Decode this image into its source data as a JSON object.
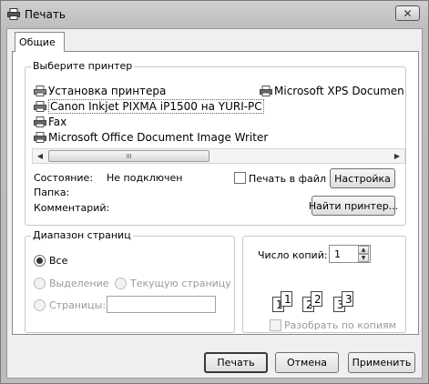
{
  "window": {
    "title": "Печать",
    "close_glyph": "✕"
  },
  "tabs": [
    {
      "label": "Общие"
    }
  ],
  "printer_select": {
    "legend": "Выберите принтер",
    "printers": [
      {
        "name": "Установка принтера"
      },
      {
        "name": "Microsoft XPS Documen"
      },
      {
        "name": "Canon Inkjet PIXMA iP1500 на YURI-PC",
        "selected": true
      },
      {
        "name": "Fax"
      },
      {
        "name": "Microsoft Office Document Image Writer"
      }
    ],
    "scroll_thumb_grip": "III",
    "status_label": "Состояние:",
    "status_value": "Не подключен",
    "folder_label": "Папка:",
    "comment_label": "Комментарий:",
    "print_to_file_label": "Печать в файл",
    "settings_button": "Настройка",
    "find_printer_button": "Найти принтер..."
  },
  "page_range": {
    "legend": "Диапазон страниц",
    "all_label": "Все",
    "selection_label": "Выделение",
    "current_page_label": "Текущую страницу",
    "pages_label": "Страницы:",
    "pages_value": ""
  },
  "copies": {
    "label": "Число копий:",
    "value": "1",
    "collate_label": "Разобрать по копиям",
    "collate_pages": [
      "1",
      "1",
      "2",
      "2",
      "3",
      "3"
    ]
  },
  "footer": {
    "print_button": "Печать",
    "cancel_button": "Отмена",
    "apply_button": "Применить"
  }
}
